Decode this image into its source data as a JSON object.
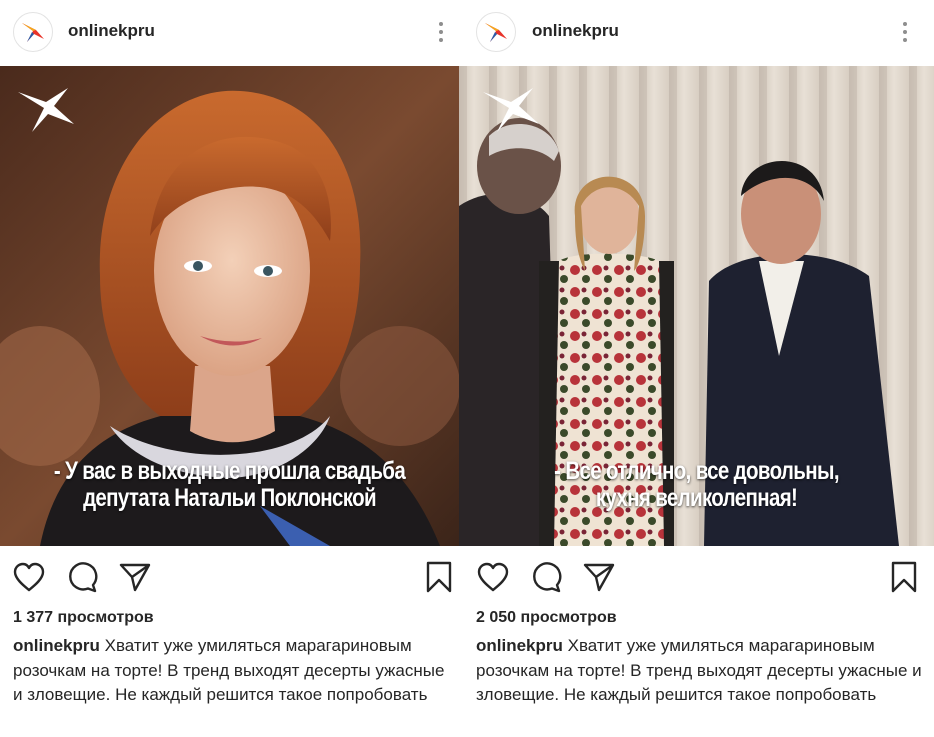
{
  "brand": {
    "accent": "#e8332a",
    "accent2": "#f4a81d",
    "accent3": "#2a5ba8"
  },
  "posts": [
    {
      "username": "onlinekpru",
      "overlay_text_line1": "- У вас в выходные прошла свадьба",
      "overlay_text_line2": "депутата Натальи Поклонской",
      "views": "1 377 просмотров",
      "caption_user": "onlinekpru",
      "caption_text": " Хватит уже умиляться марагариновым розочкам на торте! В тренд выходят десерты ужасные и зловещие. Не каждый решится такое попробовать",
      "icons": [
        "heart-icon",
        "comment-icon",
        "share-icon",
        "bookmark-icon"
      ]
    },
    {
      "username": "onlinekpru",
      "overlay_text_line1": "- Все отлично, все довольны,",
      "overlay_text_line2": "кухня великолепная!",
      "views": "2 050 просмотров",
      "caption_user": "onlinekpru",
      "caption_text": " Хватит уже умиляться марагариновым розочкам на торте! В тренд выходят десерты ужасные и зловещие. Не каждый решится такое попробовать",
      "icons": [
        "heart-icon",
        "comment-icon",
        "share-icon",
        "bookmark-icon"
      ]
    }
  ]
}
